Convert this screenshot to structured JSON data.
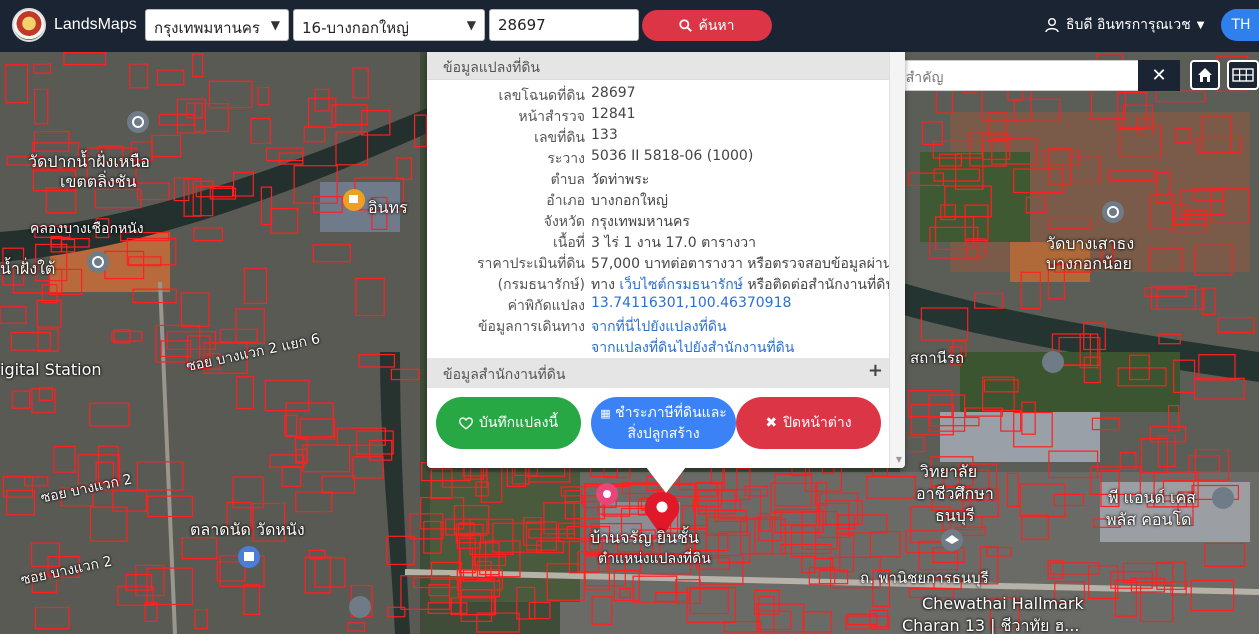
{
  "topbar": {
    "app_name": "LandsMaps",
    "province_select": "กรุงเทพมหานคร",
    "district_select": "16-บางกอกใหญ่",
    "deed_number_input": "28697",
    "search_button": "ค้นหา",
    "user_name": "ธิบดี อินทรการุณเวช",
    "avatar_initials": "TH"
  },
  "place_search": {
    "placeholder": "ค้นหาสถานที่สำคัญ",
    "clear": "✕"
  },
  "popup": {
    "title": "ข้อมูลแปลงที่ดิน",
    "rows": [
      {
        "label": "เลขโฉนดที่ดิน",
        "value": "28697"
      },
      {
        "label": "หน้าสำรวจ",
        "value": "12841"
      },
      {
        "label": "เลขที่ดิน",
        "value": "133"
      },
      {
        "label": "ระวาง",
        "value": "5036 II 5818-06 (1000)"
      },
      {
        "label": "ตำบล",
        "value": "วัดท่าพระ"
      },
      {
        "label": "อำเภอ",
        "value": "บางกอกใหญ่"
      },
      {
        "label": "จังหวัด",
        "value": "กรุงเทพมหานคร"
      },
      {
        "label": "เนื้อที่",
        "value": "3 ไร่ 1 งาน 17.0 ตารางวา"
      }
    ],
    "price_label_1": "ราคาประเมินที่ดิน",
    "price_label_2": "(กรมธนารักษ์)",
    "price_value_1": "57,000 บาทต่อตารางวา หรือตรวจสอบข้อมูลผ่าน",
    "price_value_2a": "ทาง",
    "price_value_2_link": "เว็บไซต์กรมธนารักษ์",
    "price_value_2b": "หรือติดต่อสำนักงานที่ดิน",
    "coord_label": "ค่าพิกัดแปลง",
    "coord_value": "13.74116301,100.46370918",
    "travel_label": "ข้อมูลการเดินทาง",
    "travel_link_1": "จากที่นี่ไปยังแปลงที่ดิน",
    "travel_link_2": "จากแปลงที่ดินไปยังสำนักงานที่ดิน",
    "office_section": "ข้อมูลสำนักงานที่ดิน",
    "office_expand": "+",
    "btn_save": "บันทึกแปลงนี้",
    "btn_tax_1": "ชำระภาษีที่ดินและ",
    "btn_tax_2": "สิ่งปลูกสร้าง",
    "btn_close": "ปิดหน้าต่าง"
  },
  "map_labels": {
    "l1": "วัดปากน้ำฝั่งเหนือ",
    "l2": "เขตตลิ่งชัน",
    "l3": "คลองบางเชือกหนัง",
    "l4": "น้ำฝั่งใต้",
    "l5": "igital Station",
    "l6": "ซอย บางแวก 2 แยก 6",
    "l7": "ตลาดนัด วัดหนัง",
    "l8": "บ้านจรัญ ยินชั้น",
    "l9": "ตำแหน่งแปลงที่ดิน",
    "l10": "วัดบางเสาธง",
    "l11": "บางกอกน้อย",
    "l12": "วิทยาลัย",
    "l13": "อาชีวศึกษา",
    "l14": "ธนบุรี",
    "l15": "Chewathai Hallmark",
    "l16": "Charan 13 | ชีวาทัย ฮ...",
    "l17": "พี แอนด์ เคส",
    "l18": "พลัส คอนโด",
    "l19": "ถ. พานิชยการธนบุรี",
    "l20": "อินทร",
    "l21": "ซอย บางแวก 2",
    "l22": "ซอย บางแวก 2",
    "l23": "สถานีรถ"
  },
  "colors": {
    "topbar": "#1b2433",
    "search_btn": "#dc3545",
    "save_btn": "#28a745",
    "tax_btn": "#3b82f6",
    "close_btn": "#dc3545",
    "parcel_line": "#ff2020"
  }
}
